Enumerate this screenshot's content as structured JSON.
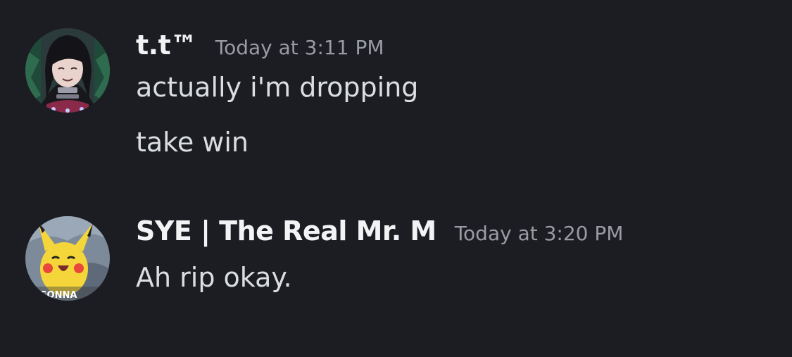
{
  "colors": {
    "background": "#1c1d22",
    "username": "#f2f3f5",
    "timestamp": "#9a9ca3",
    "message_text": "#dbdee1"
  },
  "messages": [
    {
      "username": "t.t™",
      "timestamp": "Today at 3:11 PM",
      "avatar_icon": "anime-girl-avatar",
      "lines": [
        "actually i'm dropping",
        "take win"
      ]
    },
    {
      "username": "SYE | The Real Mr. M",
      "timestamp": "Today at 3:20 PM",
      "avatar_icon": "pikachu-avatar",
      "avatar_caption": "S GONNA",
      "lines": [
        "Ah rip okay."
      ]
    }
  ]
}
